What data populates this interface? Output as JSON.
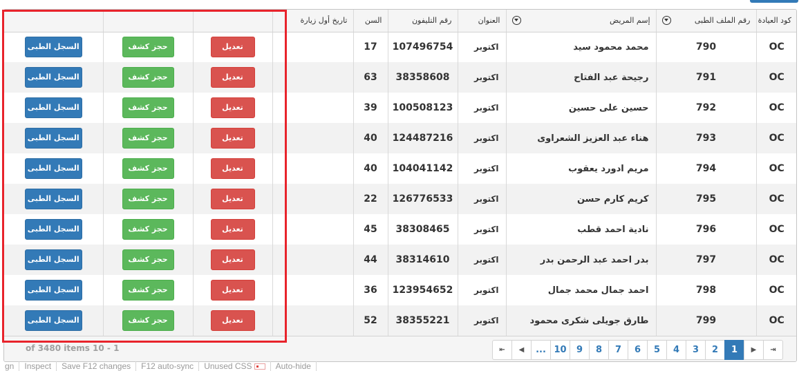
{
  "columns": {
    "clinic_code": "كود العيادة",
    "file_no": "رقم الملف الطبى",
    "patient_name": "إسم المريض",
    "address": "العنوان",
    "phone": "رقم التليفون",
    "age": "السن",
    "first_visit": "تاريخ أول زيارة"
  },
  "actions": {
    "edit": "تعديل",
    "book": "حجز كشف",
    "record": "السجل الطبى"
  },
  "rows": [
    {
      "code": "OC",
      "file": "790",
      "name": "محمد محمود سيد",
      "addr": "اكتوبر",
      "phone": "107496754",
      "age": "17",
      "visit": ""
    },
    {
      "code": "OC",
      "file": "791",
      "name": "رجيحة عبد الفتاح",
      "addr": "اكتوبر",
      "phone": "38358608",
      "age": "63",
      "visit": ""
    },
    {
      "code": "OC",
      "file": "792",
      "name": "حسين على حسين",
      "addr": "اكتوبر",
      "phone": "100508123",
      "age": "39",
      "visit": ""
    },
    {
      "code": "OC",
      "file": "793",
      "name": "هناء عبد العزيز الشعراوى",
      "addr": "اكتوبر",
      "phone": "124487216",
      "age": "40",
      "visit": ""
    },
    {
      "code": "OC",
      "file": "794",
      "name": "مريم ادورد يعقوب",
      "addr": "اكتوبر",
      "phone": "104041142",
      "age": "40",
      "visit": ""
    },
    {
      "code": "OC",
      "file": "795",
      "name": "كريم كارم حسن",
      "addr": "اكتوبر",
      "phone": "126776533",
      "age": "22",
      "visit": ""
    },
    {
      "code": "OC",
      "file": "796",
      "name": "نادية احمد قطب",
      "addr": "اكتوبر",
      "phone": "38308465",
      "age": "45",
      "visit": ""
    },
    {
      "code": "OC",
      "file": "797",
      "name": "بدر احمد عبد الرحمن بدر",
      "addr": "اكتوبر",
      "phone": "38314610",
      "age": "44",
      "visit": ""
    },
    {
      "code": "OC",
      "file": "798",
      "name": "احمد جمال محمد جمال",
      "addr": "اكتوبر",
      "phone": "123954652",
      "age": "36",
      "visit": ""
    },
    {
      "code": "OC",
      "file": "799",
      "name": "طارق جويلى شكرى محمود",
      "addr": "اكتوبر",
      "phone": "38355221",
      "age": "52",
      "visit": ""
    }
  ],
  "pager": {
    "info": "of 3480 items 10 - 1",
    "first": "⇤",
    "prev": "◀",
    "ellipsis": "...",
    "pages_ltr": [
      "10",
      "9",
      "8",
      "7",
      "6",
      "5",
      "4",
      "3",
      "2",
      "1"
    ],
    "active_page": "1",
    "next": "▶",
    "last": "⇥"
  },
  "devbar": {
    "items": [
      "gn",
      "Inspect",
      "Save F12 changes",
      "F12 auto-sync",
      "Unused CSS",
      "Auto-hide"
    ]
  },
  "colors": {
    "edit_button": "#d9534f",
    "book_button": "#5cb85c",
    "record_button": "#337ab7",
    "active_page": "#337ab7",
    "highlight": "#e8232b"
  }
}
